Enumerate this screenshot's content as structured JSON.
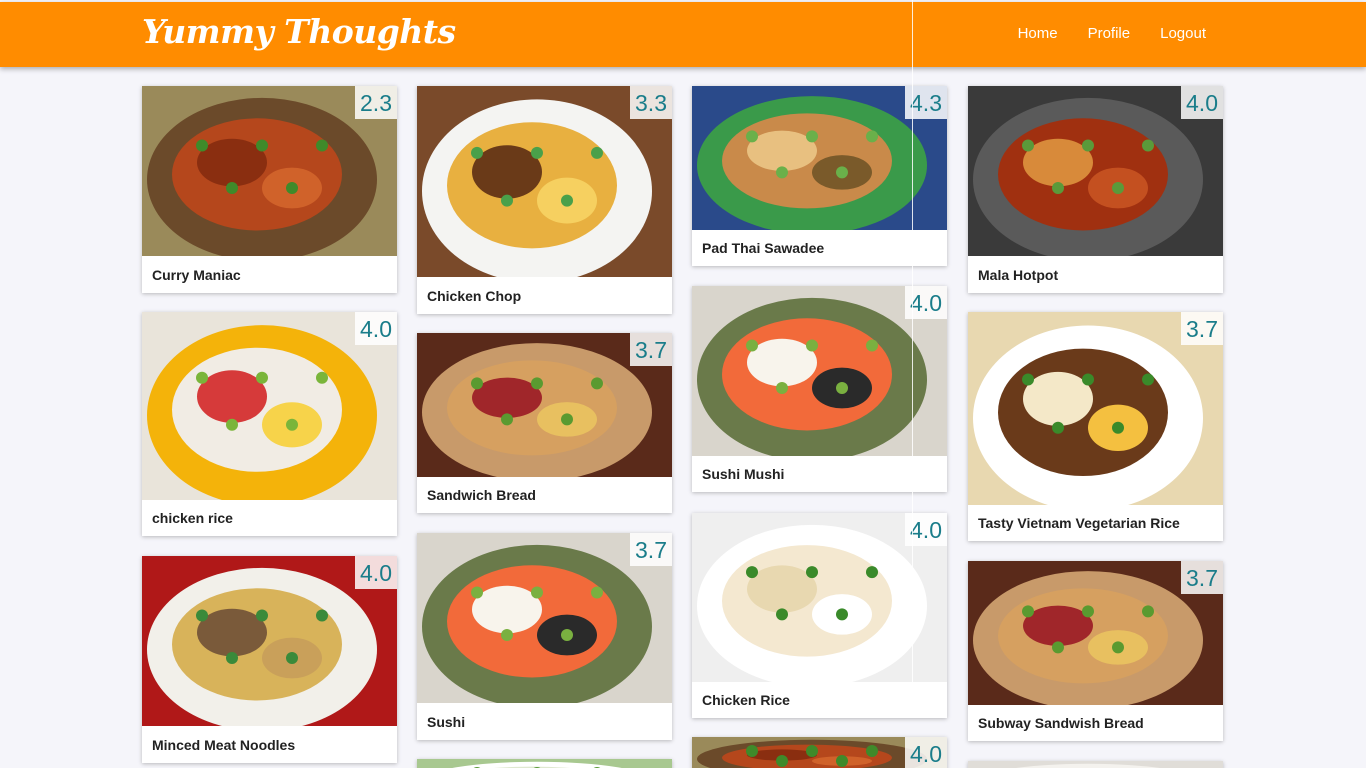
{
  "brand": "Yummy Thoughts",
  "nav": {
    "home": "Home",
    "profile": "Profile",
    "logout": "Logout"
  },
  "colors": {
    "header": "#ff8c00",
    "rating": "#1a7d8a"
  },
  "cards": [
    {
      "title": "Curry Maniac",
      "rating": "2.3",
      "theme": "curry"
    },
    {
      "title": "chicken rice",
      "rating": "4.0",
      "theme": "dessert"
    },
    {
      "title": "Minced Meat Noodles",
      "rating": "4.0",
      "theme": "noodles"
    },
    {
      "title": "Chicken Chop",
      "rating": "3.3",
      "theme": "chop"
    },
    {
      "title": "Sandwich Bread",
      "rating": "3.7",
      "theme": "sandwich"
    },
    {
      "title": "Sushi",
      "rating": "3.7",
      "theme": "sushi"
    },
    {
      "title": "",
      "rating": "",
      "theme": "green"
    },
    {
      "title": "Pad Thai Sawadee",
      "rating": "4.3",
      "theme": "padthai"
    },
    {
      "title": "Sushi Mushi",
      "rating": "4.0",
      "theme": "sushi"
    },
    {
      "title": "Chicken Rice",
      "rating": "4.0",
      "theme": "chickenrice"
    },
    {
      "title": "",
      "rating": "4.0",
      "theme": "curry"
    },
    {
      "title": "Mala Hotpot",
      "rating": "4.0",
      "theme": "hotpot"
    },
    {
      "title": "Tasty Vietnam Vegetarian Rice",
      "rating": "3.7",
      "theme": "vietnam"
    },
    {
      "title": "Subway Sandwish Bread",
      "rating": "3.7",
      "theme": "sandwich"
    },
    {
      "title": "",
      "rating": "",
      "theme": "plain"
    }
  ]
}
